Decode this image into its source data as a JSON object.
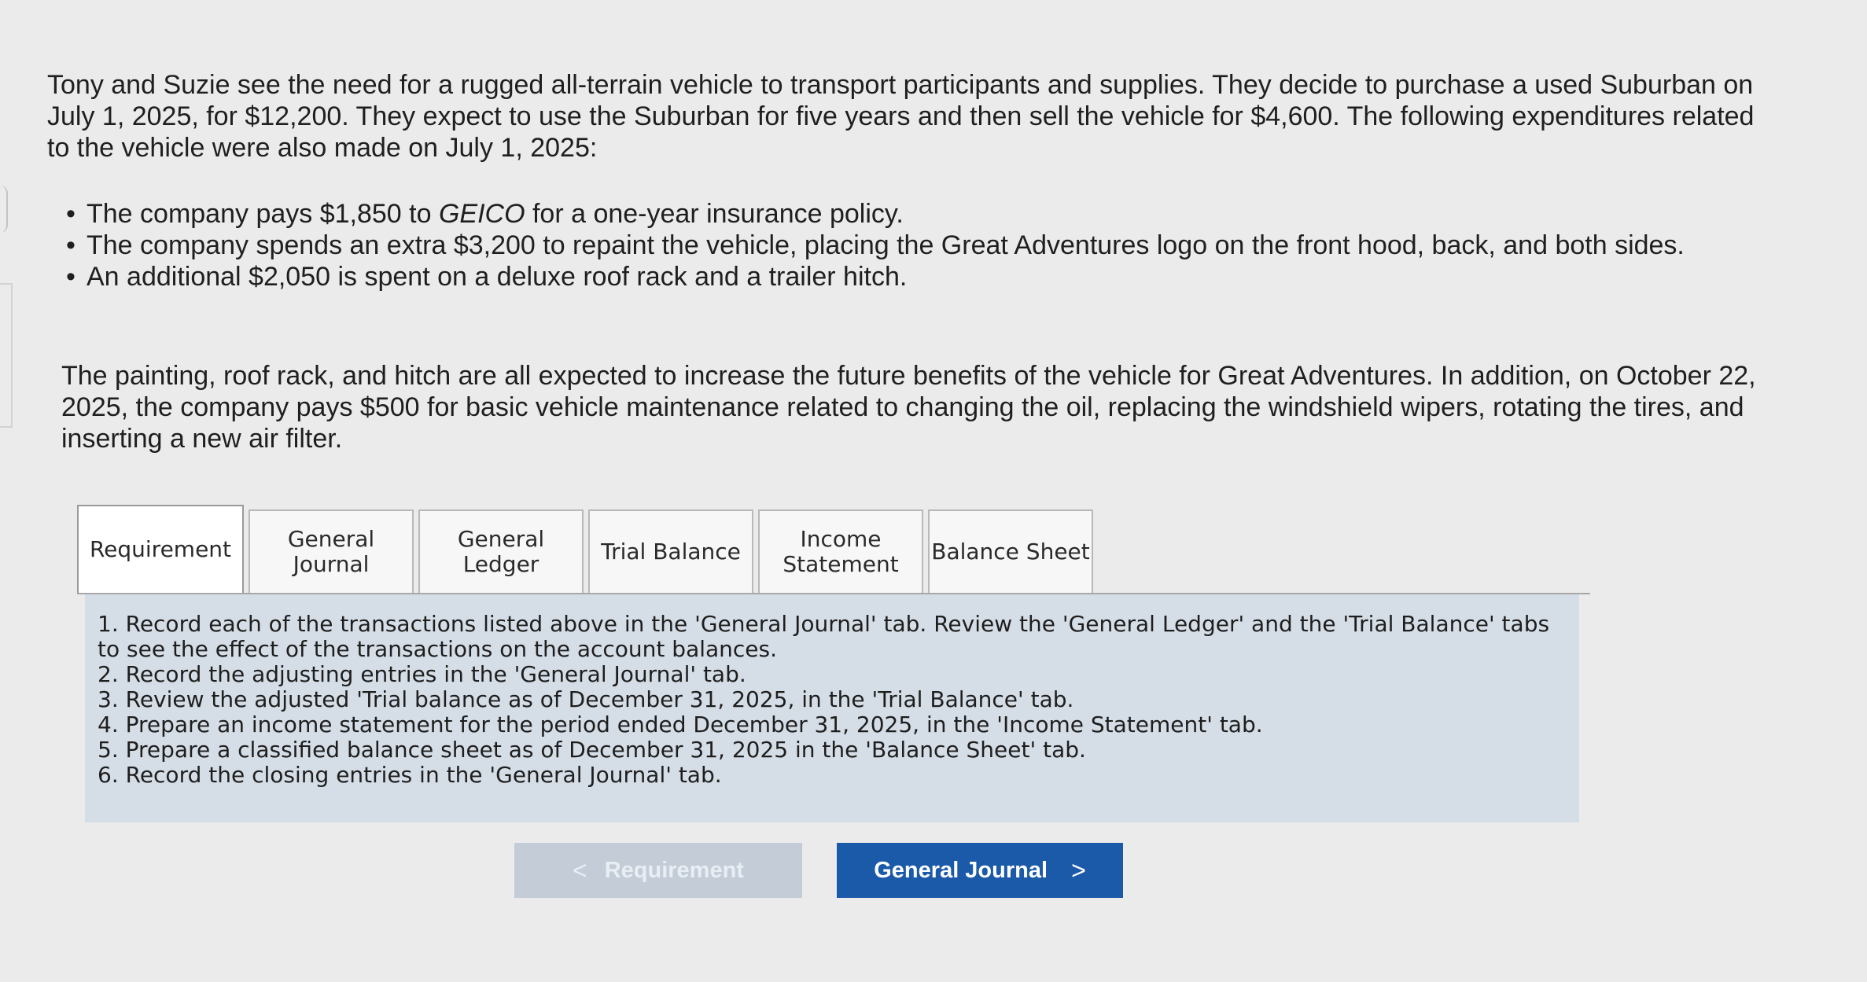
{
  "problem": {
    "intro": "Tony and Suzie see the need for a rugged all-terrain vehicle to transport participants and supplies. They decide to purchase a used Suburban on July 1, 2025, for $12,200. They expect to use the Suburban for five years and then sell the vehicle for $4,600. The following expenditures related to the vehicle were also made on July 1, 2025:",
    "bullets": [
      {
        "before": "The company pays $1,850 to ",
        "italic": "GEICO",
        "after": " for a one-year insurance policy."
      },
      {
        "before": "The company spends an extra $3,200 to repaint the vehicle, placing the Great Adventures logo on the front hood, back, and both sides.",
        "italic": "",
        "after": ""
      },
      {
        "before": "An additional $2,050 is spent on a deluxe roof rack and a trailer hitch.",
        "italic": "",
        "after": ""
      }
    ],
    "paragraph": "The painting, roof rack, and hitch are all expected to increase the future benefits of the vehicle for Great Adventures. In addition, on October 22, 2025, the company pays $500 for basic vehicle maintenance related to changing the oil, replacing the windshield wipers, rotating the tires, and inserting a new air filter."
  },
  "tabs": {
    "requirement": "Requirement",
    "general_journal": "General Journal",
    "general_ledger": "General Ledger",
    "trial_balance": "Trial Balance",
    "income_statement": "Income Statement",
    "balance_sheet": "Balance Sheet",
    "active": "Requirement"
  },
  "instructions": [
    "1. Record each of the transactions listed above in the 'General Journal' tab. Review the 'General Ledger' and the 'Trial Balance' tabs to see the effect of the transactions on the account balances.",
    "2. Record the adjusting entries in the 'General Journal' tab.",
    "3. Review the adjusted 'Trial balance as of December 31, 2025, in the 'Trial Balance' tab.",
    "4. Prepare an income statement for the period ended December 31, 2025, in the 'Income Statement' tab.",
    "5. Prepare a classified balance sheet as of December 31, 2025 in the 'Balance Sheet' tab.",
    "6. Record the closing entries in the 'General Journal' tab."
  ],
  "nav": {
    "prev_label": "Requirement",
    "prev_icon": "chevron-left-icon",
    "prev_glyph": "<",
    "next_label": "General Journal",
    "next_icon": "chevron-right-icon",
    "next_glyph": ">"
  },
  "colors": {
    "page_background": "#ebebeb",
    "instruction_panel": "#d5dde6",
    "next_button": "#1b5aa8",
    "prev_button_disabled": "#c3ccd7"
  }
}
